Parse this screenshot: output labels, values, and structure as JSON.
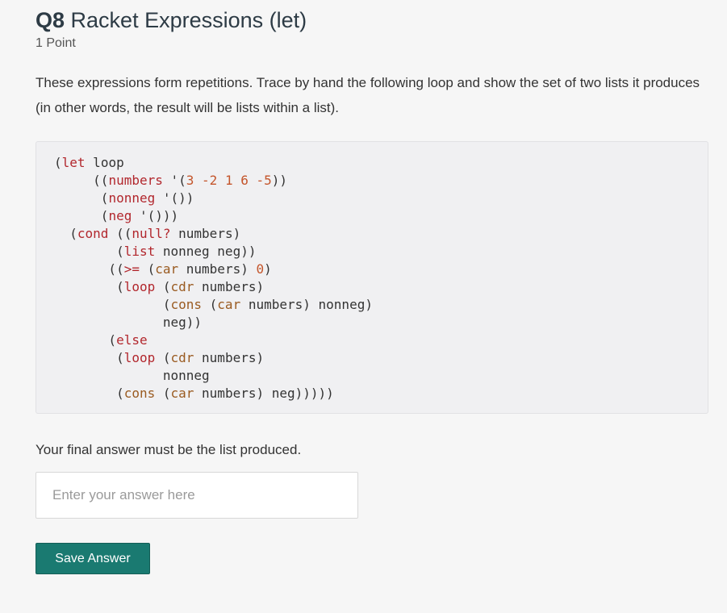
{
  "question": {
    "number": "Q8",
    "title": "Racket Expressions (let)",
    "points": "1 Point",
    "description": "These expressions form repetitions. Trace by hand the following loop and show the set of two lists it produces (in other words, the result will be lists within a list).",
    "final_note": "Your final answer must be the list produced."
  },
  "code": {
    "lines": [
      [
        {
          "t": "(",
          "c": ""
        },
        {
          "t": "let",
          "c": "kw"
        },
        {
          "t": " loop",
          "c": ""
        }
      ],
      [
        {
          "t": "     ((",
          "c": ""
        },
        {
          "t": "numbers",
          "c": "kw"
        },
        {
          "t": " '(",
          "c": ""
        },
        {
          "t": "3 -2 1 6 -5",
          "c": "num"
        },
        {
          "t": "))",
          "c": ""
        }
      ],
      [
        {
          "t": "      (",
          "c": ""
        },
        {
          "t": "nonneg",
          "c": "kw"
        },
        {
          "t": " '())",
          "c": ""
        }
      ],
      [
        {
          "t": "      (",
          "c": ""
        },
        {
          "t": "neg",
          "c": "kw"
        },
        {
          "t": " '()))",
          "c": ""
        }
      ],
      [
        {
          "t": "  (",
          "c": ""
        },
        {
          "t": "cond",
          "c": "kw"
        },
        {
          "t": " ((",
          "c": ""
        },
        {
          "t": "null?",
          "c": "kw"
        },
        {
          "t": " numbers)",
          "c": ""
        }
      ],
      [
        {
          "t": "        (",
          "c": ""
        },
        {
          "t": "list",
          "c": "kw"
        },
        {
          "t": " nonneg neg))",
          "c": ""
        }
      ],
      [
        {
          "t": "       ((",
          "c": ""
        },
        {
          "t": ">=",
          "c": "kw"
        },
        {
          "t": " (",
          "c": ""
        },
        {
          "t": "car",
          "c": "bi"
        },
        {
          "t": " numbers) ",
          "c": ""
        },
        {
          "t": "0",
          "c": "num"
        },
        {
          "t": ")",
          "c": ""
        }
      ],
      [
        {
          "t": "        (",
          "c": ""
        },
        {
          "t": "loop",
          "c": "kw"
        },
        {
          "t": " (",
          "c": ""
        },
        {
          "t": "cdr",
          "c": "bi"
        },
        {
          "t": " numbers)",
          "c": ""
        }
      ],
      [
        {
          "t": "              (",
          "c": ""
        },
        {
          "t": "cons",
          "c": "bi"
        },
        {
          "t": " (",
          "c": ""
        },
        {
          "t": "car",
          "c": "bi"
        },
        {
          "t": " numbers) nonneg)",
          "c": ""
        }
      ],
      [
        {
          "t": "              neg))",
          "c": ""
        }
      ],
      [
        {
          "t": "       (",
          "c": ""
        },
        {
          "t": "else",
          "c": "kw"
        }
      ],
      [
        {
          "t": "        (",
          "c": ""
        },
        {
          "t": "loop",
          "c": "kw"
        },
        {
          "t": " (",
          "c": ""
        },
        {
          "t": "cdr",
          "c": "bi"
        },
        {
          "t": " numbers)",
          "c": ""
        }
      ],
      [
        {
          "t": "              nonneg",
          "c": ""
        }
      ],
      [
        {
          "t": "        (",
          "c": ""
        },
        {
          "t": "cons",
          "c": "bi"
        },
        {
          "t": " (",
          "c": ""
        },
        {
          "t": "car",
          "c": "bi"
        },
        {
          "t": " numbers) neg)))))",
          "c": ""
        }
      ]
    ]
  },
  "answer": {
    "placeholder": "Enter your answer here",
    "value": ""
  },
  "actions": {
    "save_label": "Save Answer"
  },
  "colors": {
    "keyword": "#b2272d",
    "number": "#c4552b",
    "builtin": "#9a5b21",
    "button": "#1a7a71"
  }
}
